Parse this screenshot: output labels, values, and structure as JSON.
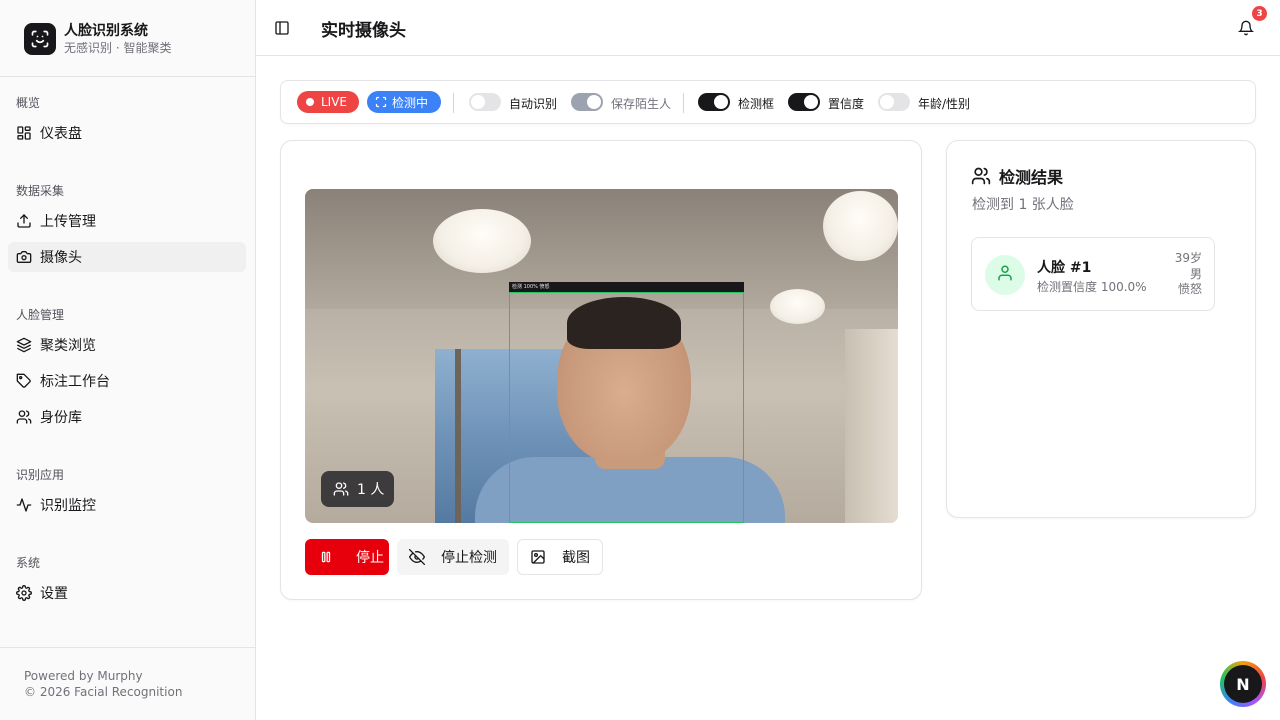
{
  "brand": {
    "title": "人脸识别系统",
    "subtitle": "无感识别 · 智能聚类"
  },
  "nav": {
    "groups": [
      {
        "label": "概览",
        "items": [
          {
            "label": "仪表盘",
            "icon": "dashboard-icon"
          }
        ]
      },
      {
        "label": "数据采集",
        "items": [
          {
            "label": "上传管理",
            "icon": "upload-icon"
          },
          {
            "label": "摄像头",
            "icon": "camera-icon",
            "active": true
          }
        ]
      },
      {
        "label": "人脸管理",
        "items": [
          {
            "label": "聚类浏览",
            "icon": "layers-icon"
          },
          {
            "label": "标注工作台",
            "icon": "tag-icon"
          },
          {
            "label": "身份库",
            "icon": "users-icon"
          }
        ]
      },
      {
        "label": "识别应用",
        "items": [
          {
            "label": "识别监控",
            "icon": "activity-icon"
          }
        ]
      },
      {
        "label": "系统",
        "items": [
          {
            "label": "设置",
            "icon": "gear-icon"
          }
        ]
      }
    ]
  },
  "footer": {
    "line1": "Powered by Murphy",
    "line2": "© 2026 Facial Recognition"
  },
  "header": {
    "title": "实时摄像头",
    "notification_count": "3"
  },
  "toolbar": {
    "live_label": "LIVE",
    "detect_label": "检测中",
    "switches": {
      "auto_recognize": {
        "label": "自动识别",
        "state": "off"
      },
      "save_stranger": {
        "label": "保存陌生人",
        "state": "disabled-on"
      },
      "detect_box": {
        "label": "检测框",
        "state": "on"
      },
      "confidence": {
        "label": "置信度",
        "state": "on"
      },
      "age_gender": {
        "label": "年龄/性别",
        "state": "off"
      }
    }
  },
  "camera": {
    "person_count": "1 人",
    "detection_label": "检测 100%  愤怒",
    "buttons": {
      "stop": "停止",
      "stop_detect": "停止检测",
      "screenshot": "截图"
    }
  },
  "results": {
    "title": "检测结果",
    "subtitle": "检测到 1 张人脸",
    "faces": [
      {
        "name": "人脸 #1",
        "confidence": "检测置信度 100.0%",
        "age": "39岁",
        "gender": "男",
        "emotion": "愤怒"
      }
    ]
  },
  "floating": {
    "label": "N"
  },
  "colors": {
    "accent_red": "#e7000b",
    "accent_blue": "#3b82f6",
    "detect_green": "#22c55e"
  }
}
